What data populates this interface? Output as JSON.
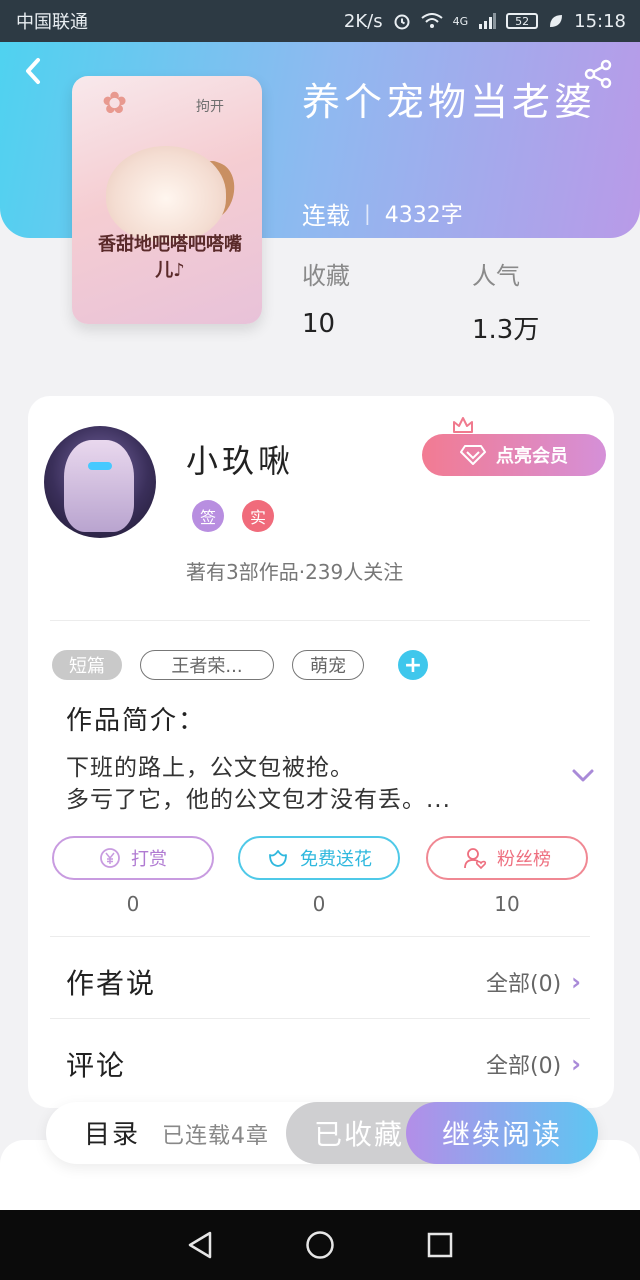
{
  "status_bar": {
    "carrier": "中国联通",
    "speed": "2K/s",
    "battery": "52",
    "time": "15:18",
    "signal_label": "4G"
  },
  "book": {
    "title": "养个宠物当老婆",
    "status": "连载",
    "separator": "|",
    "word_count": "4332字",
    "cover_text": "香甜地吧嗒吧嗒嘴儿♪",
    "cover_tag": "拘开"
  },
  "stats": {
    "favorites_label": "收藏",
    "favorites_value": "10",
    "popularity_label": "人气",
    "popularity_value": "1.3万"
  },
  "author": {
    "name": "小玖啾",
    "member_button": "点亮会员",
    "badge_sign": "签",
    "badge_real": "实",
    "works_info": "著有3部作品·239人关注"
  },
  "tags": [
    "短篇",
    "王者荣...",
    "萌宠"
  ],
  "tag_add": "+",
  "intro": {
    "title": "作品简介：",
    "line1": "下班的路上，公文包被抢。",
    "line2": "多亏了它，他的公文包才没有丢。..."
  },
  "actions": {
    "tip_label": "打赏",
    "tip_count": "0",
    "flower_label": "免费送花",
    "flower_count": "0",
    "fans_label": "粉丝榜",
    "fans_count": "10"
  },
  "author_says": {
    "title": "作者说",
    "link": "全部(0)"
  },
  "comments": {
    "title": "评论",
    "link": "全部(0)"
  },
  "bottom_bar": {
    "toc": "目录",
    "chapters": "已连载4章",
    "collected": "已收藏",
    "continue": "继续阅读"
  },
  "colors": {
    "hero_start": "#4fd2f0",
    "hero_end": "#b99ae8",
    "accent_purple": "#b07ad2",
    "accent_cyan": "#2fb8de",
    "accent_pink": "#ee6f7f"
  }
}
